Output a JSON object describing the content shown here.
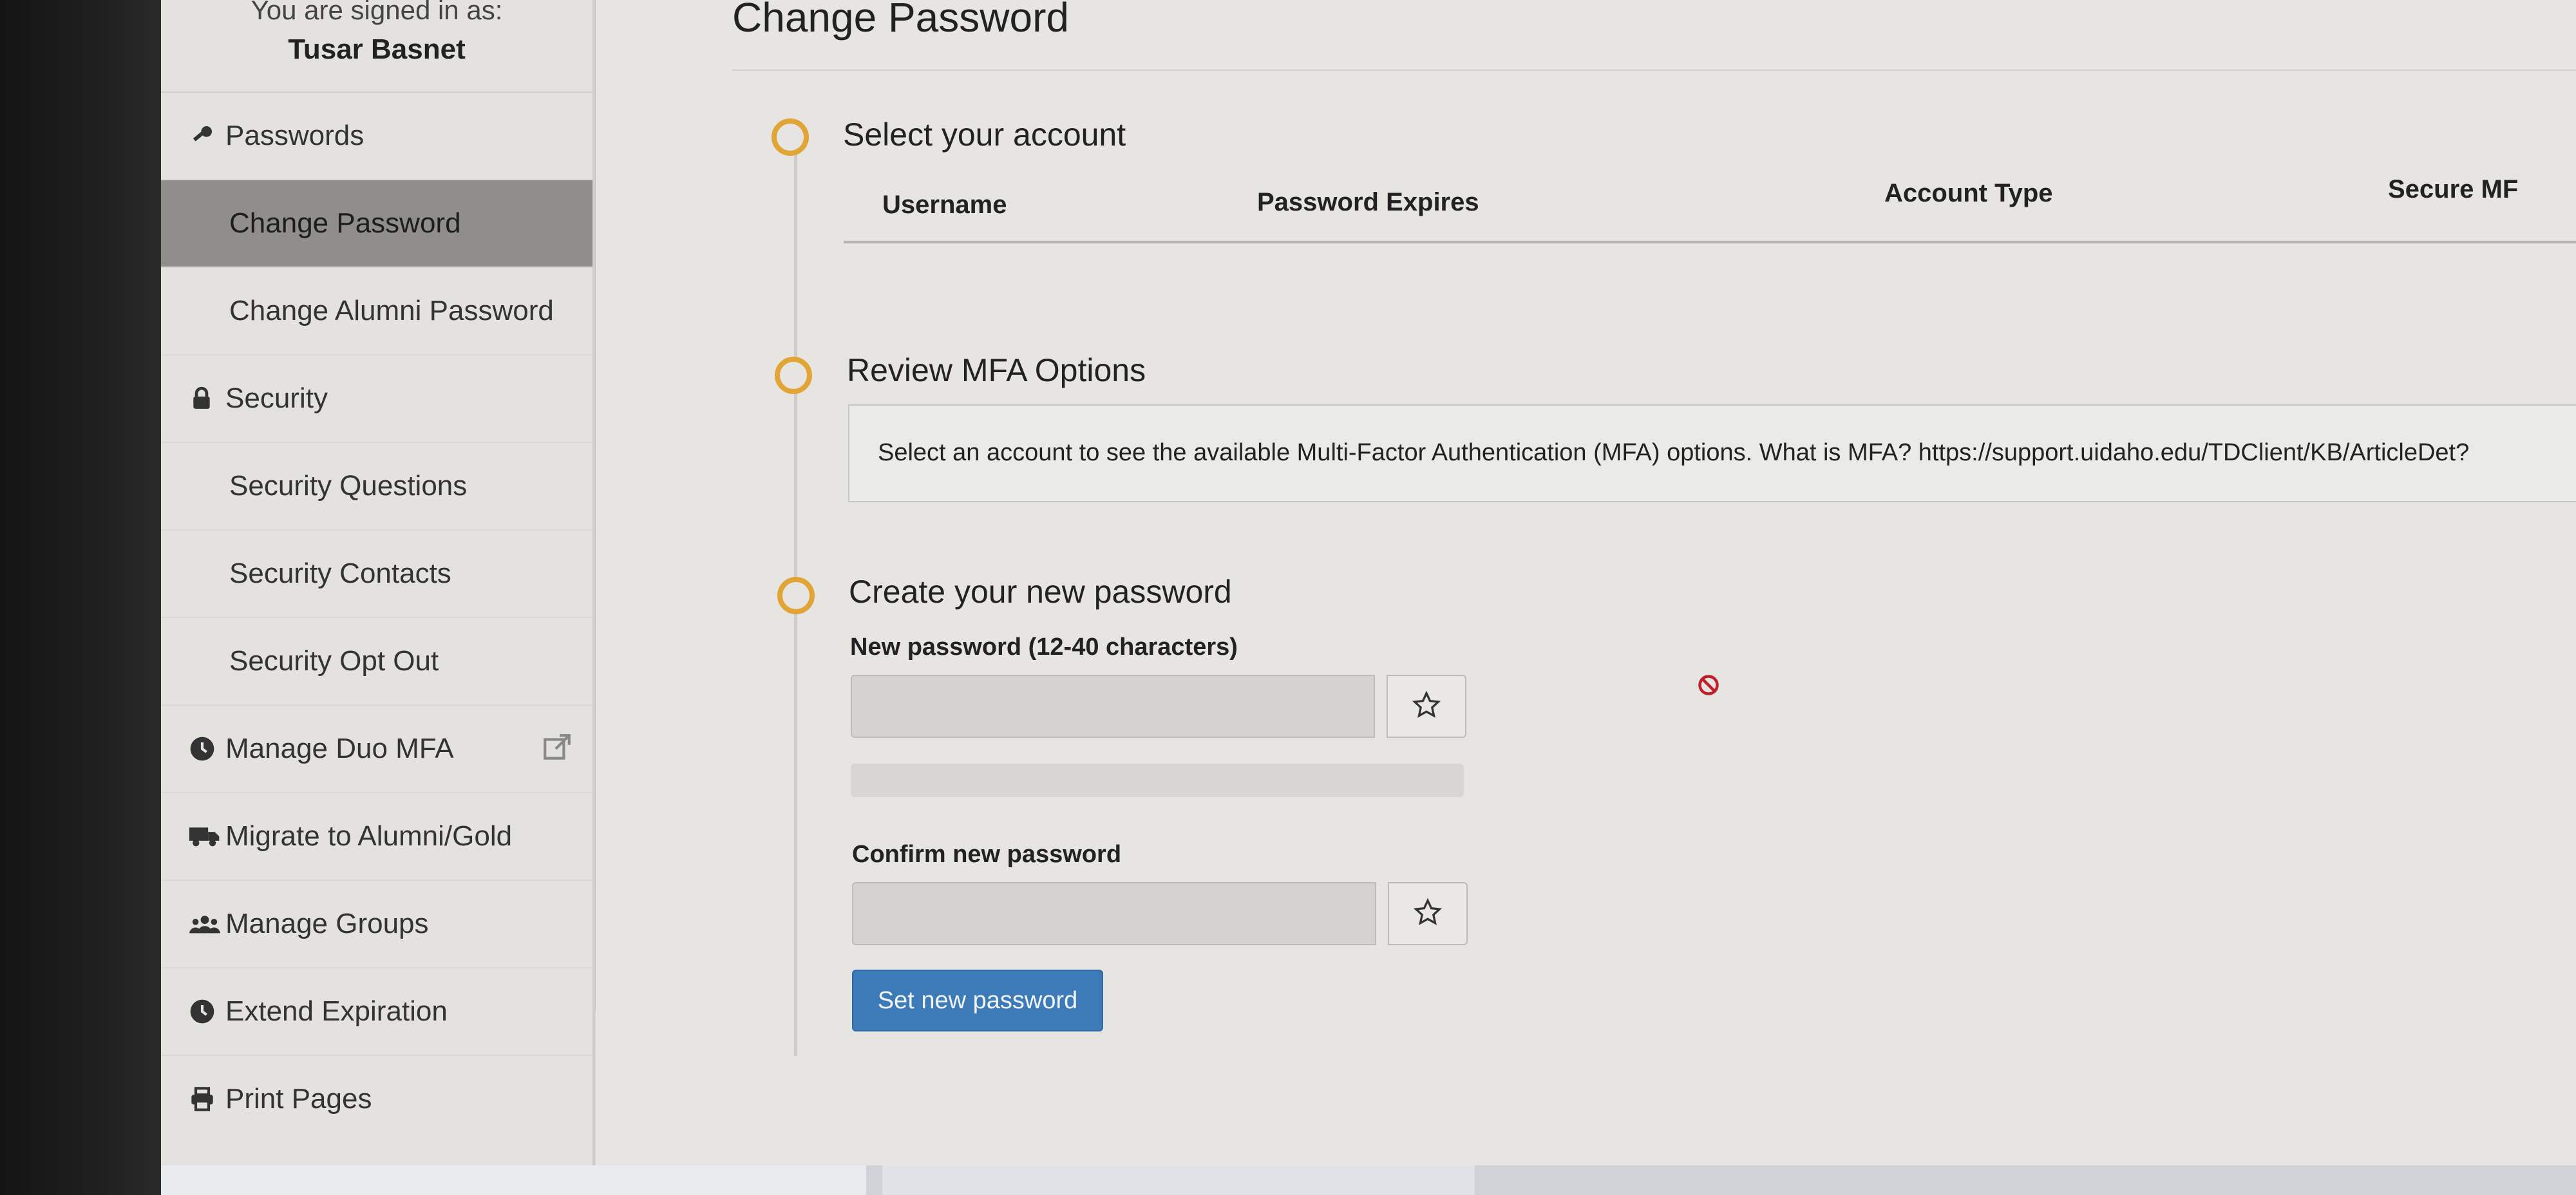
{
  "sidebar": {
    "signed_in_label": "You are signed in as:",
    "user_name": "Tusar Basnet",
    "items": [
      {
        "label": "Passwords",
        "icon": "key-icon",
        "level": "top"
      },
      {
        "label": "Change Password",
        "level": "sub",
        "active": true
      },
      {
        "label": "Change Alumni Password",
        "level": "sub"
      },
      {
        "label": "Security",
        "icon": "lock-icon",
        "level": "top"
      },
      {
        "label": "Security Questions",
        "level": "sub"
      },
      {
        "label": "Security Contacts",
        "level": "sub"
      },
      {
        "label": "Security Opt Out",
        "level": "sub"
      },
      {
        "label": "Manage Duo MFA",
        "icon": "clock-icon",
        "level": "top",
        "external": true
      },
      {
        "label": "Migrate to Alumni/Gold",
        "icon": "truck-icon",
        "level": "top"
      },
      {
        "label": "Manage Groups",
        "icon": "users-icon",
        "level": "top"
      },
      {
        "label": "Extend Expiration",
        "icon": "clock-icon",
        "level": "top"
      },
      {
        "label": "Print Pages",
        "icon": "print-icon",
        "level": "top"
      }
    ]
  },
  "main": {
    "page_title": "Change Password",
    "steps": [
      {
        "title": "Select your account"
      },
      {
        "title": "Review MFA Options"
      },
      {
        "title": "Create your new password"
      }
    ],
    "account_table": {
      "columns": [
        "Username",
        "Password Expires",
        "Account Type",
        "Secure MF"
      ]
    },
    "mfa_message": "Select an account to see the available Multi-Factor Authentication (MFA) options. What is MFA? https://support.uidaho.edu/TDClient/KB/ArticleDet?",
    "new_password_label": "New password (12-40 characters)",
    "confirm_password_label": "Confirm new password",
    "submit_label": "Set new password"
  },
  "colors": {
    "accent_orange": "#e1a437",
    "button_blue": "#3d7ab8",
    "active_nav": "#8f8e8b"
  }
}
